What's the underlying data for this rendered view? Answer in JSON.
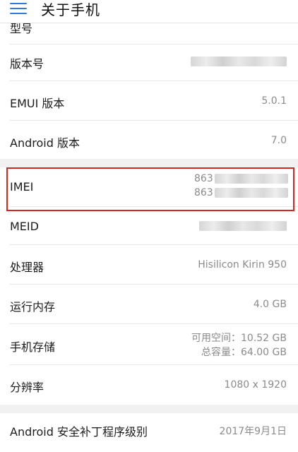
{
  "header": {
    "title": "关于手机",
    "menu_icon": "hamburger-menu-icon",
    "accent_color": "#2b7be0"
  },
  "rows": {
    "model_partial": {
      "label": "型号"
    },
    "version_number": {
      "label": "版本号",
      "value_redacted": true
    },
    "emui_version": {
      "label": "EMUI 版本",
      "value": "5.0.1"
    },
    "android_version": {
      "label": "Android 版本",
      "value": "7.0"
    },
    "imei": {
      "label": "IMEI",
      "value_line1": "863",
      "value_line2": "863",
      "highlight_color": "#d8261f"
    },
    "meid": {
      "label": "MEID",
      "value_redacted": true
    },
    "processor": {
      "label": "处理器",
      "value": "Hisilicon Kirin 950"
    },
    "ram": {
      "label": "运行内存",
      "value": "4.0 GB"
    },
    "storage": {
      "label": "手机存储",
      "available": "可用空间：10.52  GB",
      "total": "总容量：64.00  GB"
    },
    "resolution": {
      "label": "分辨率",
      "value": "1080 x 1920"
    },
    "security_patch": {
      "label": "Android 安全补丁程序级别",
      "value": "2017年9月1日"
    }
  }
}
